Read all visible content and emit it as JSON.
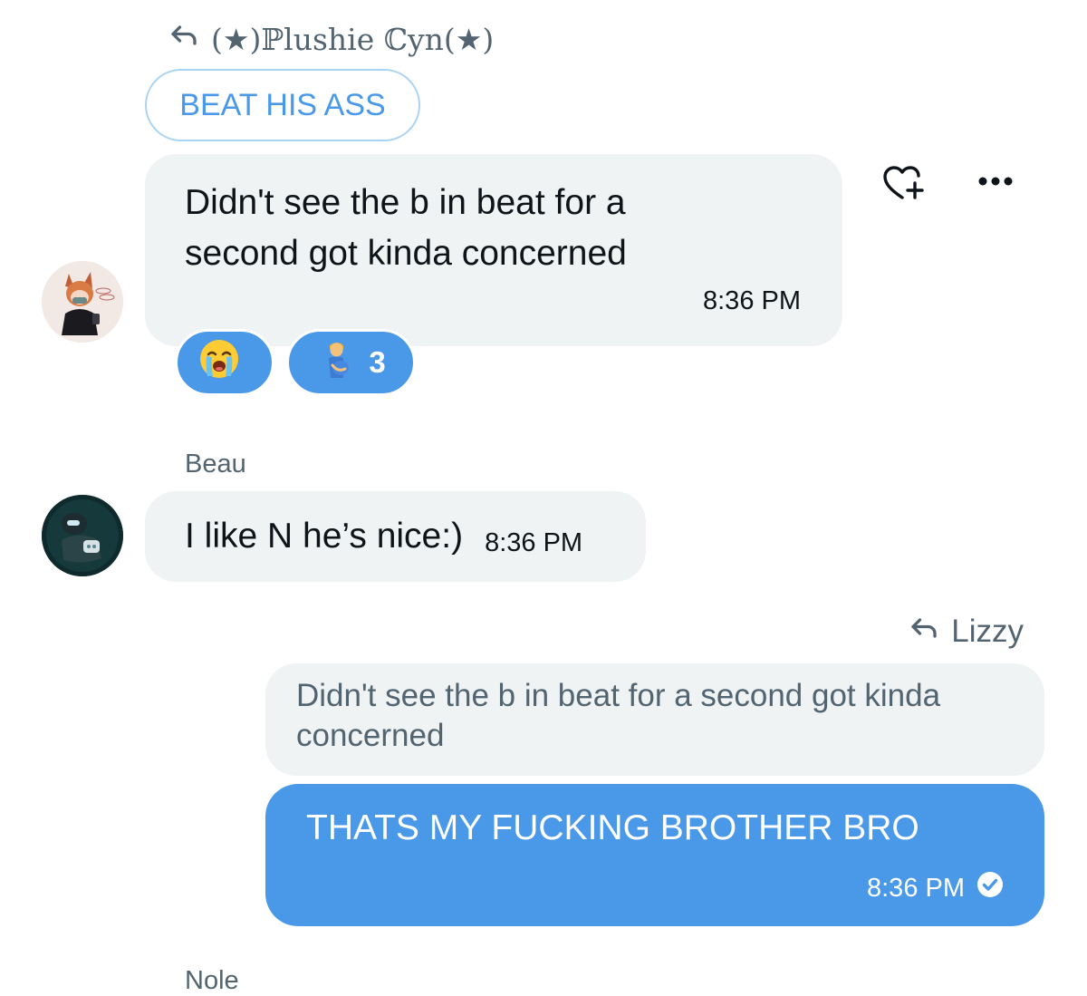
{
  "conversation": {
    "reply_header": {
      "name": "(★)ℙlushie ℂyn(★)",
      "icon": "reply-arrow-icon"
    },
    "quoted_pill": "BEAT HIS ASS",
    "messages": [
      {
        "text": "Didn't see the b in beat for a second got kinda concerned",
        "time": "8:36 PM",
        "reactions": [
          {
            "emoji": "loudly-crying-face",
            "count": ""
          },
          {
            "emoji": "pregnant-man",
            "count": "3"
          }
        ]
      },
      {
        "sender": "Beau",
        "text": "I like N he’s nice:)",
        "time": "8:36 PM"
      },
      {
        "reply_to": "Lizzy",
        "quoted_text": "Didn't see the b in beat for a second got kinda concerned",
        "text": "THATS MY FUCKING BROTHER BRO",
        "time": "8:36 PM",
        "status_icon": "read-check-icon"
      }
    ],
    "next_sender": "Nole"
  },
  "actions": {
    "react_icon": "heart-plus-icon",
    "more_icon": "more-dots-icon"
  },
  "colors": {
    "accent": "#4a99e9",
    "bubble_gray": "#eff3f4",
    "secondary_text": "#536471"
  }
}
